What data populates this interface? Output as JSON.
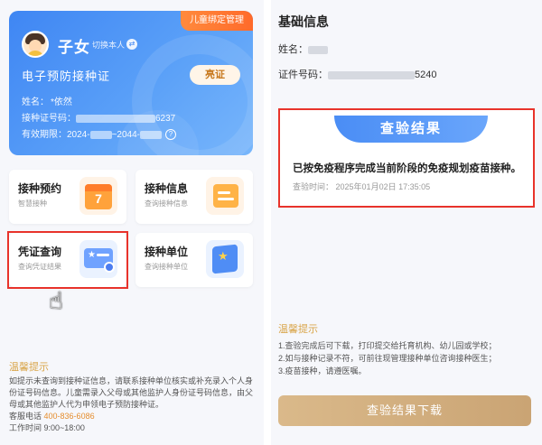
{
  "left": {
    "card": {
      "corner_tag": "儿童绑定管理",
      "name": "子女",
      "switch_label": "切换本人",
      "switch_icon": "swap-icon",
      "title": "电子预防接种证",
      "show_button": "亮证",
      "name_label": "姓名：",
      "name_value": "*依然",
      "cert_no_label": "接种证号码：",
      "cert_no_tail": "6237",
      "valid_label": "有效期限：",
      "valid_from": "2024-",
      "valid_to": "~2044-",
      "help_icon": "?"
    },
    "tiles": [
      {
        "title": "接种预约",
        "subtitle": "智慧接种",
        "icon": "calendar-icon",
        "icon_text": "7"
      },
      {
        "title": "接种信息",
        "subtitle": "查询接种信息",
        "icon": "document-icon"
      },
      {
        "title": "凭证查询",
        "subtitle": "查询凭证结果",
        "icon": "certificate-icon"
      },
      {
        "title": "接种单位",
        "subtitle": "查询接种单位",
        "icon": "location-icon"
      }
    ],
    "tips": {
      "title": "温馨提示",
      "body": "如提示未查询到接种证信息，请联系接种单位核实或补充录入个人身份证号码信息。儿童需录入父母或其他监护人身份证号码信息，由父母或其他监护人代为申领电子预防接种证。",
      "hotline_label": "客服电话",
      "hotline": "400-836-6086",
      "hours_label": "工作时间",
      "hours": "9:00~18:00"
    }
  },
  "right": {
    "title": "基础信息",
    "name_label": "姓名：",
    "id_label": "证件号码：",
    "id_tail": "5240",
    "result": {
      "heading": "查验结果",
      "message": "已按免疫程序完成当前阶段的免疫规划疫苗接种。",
      "time_label": "查验时间：",
      "time": "2025年01月02日 17:35:05"
    },
    "tips": {
      "title": "温馨提示",
      "items": [
        "1.查验完成后可下载，打印提交给托育机构、幼儿园或学校；",
        "2.如与接种记录不符，可前往现管理接种单位咨询接种医生；",
        "3.疫苗接种，请遵医嘱。"
      ]
    },
    "download_button": "查验结果下载"
  },
  "colors": {
    "card_blue": "#3f86f3",
    "highlight_red": "#e8332b",
    "tip_gold": "#d9a54a",
    "button_gold": "#caa474"
  }
}
